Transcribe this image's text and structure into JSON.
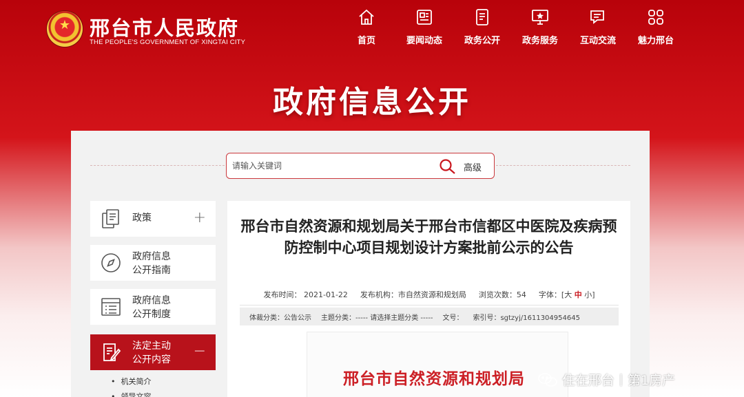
{
  "header": {
    "site_title": "邢台市人民政府",
    "site_subtitle": "THE PEOPLE'S GOVERNMENT OF XINGTAI CITY",
    "nav": [
      {
        "label": "首页",
        "icon": "home-icon"
      },
      {
        "label": "要闻动态",
        "icon": "news-icon"
      },
      {
        "label": "政务公开",
        "icon": "document-icon"
      },
      {
        "label": "政务服务",
        "icon": "monitor-star-icon"
      },
      {
        "label": "互动交流",
        "icon": "chat-icon"
      },
      {
        "label": "魅力邢台",
        "icon": "grid-icon"
      }
    ]
  },
  "hero": {
    "title": "政府信息公开"
  },
  "search": {
    "placeholder": "请输入关键词",
    "advanced_label": "高级"
  },
  "sidebar": {
    "items": [
      {
        "label_line1": "政策",
        "label_line2": "",
        "icon": "document-copy-icon",
        "toggle": "+"
      },
      {
        "label_line1": "政府信息",
        "label_line2": "公开指南",
        "icon": "compass-icon",
        "toggle": ""
      },
      {
        "label_line1": "政府信息",
        "label_line2": "公开制度",
        "icon": "list-icon",
        "toggle": ""
      },
      {
        "label_line1": "法定主动",
        "label_line2": "公开内容",
        "icon": "edit-document-icon",
        "toggle": "−"
      }
    ],
    "sub_items": [
      "机关简介",
      "领导文容"
    ]
  },
  "article": {
    "title": "邢台市自然资源和规划局关于邢台市信都区中医院及疾病预防控制中心项目规划设计方案批前公示的公告",
    "meta": {
      "publish_date_label": "发布时间：",
      "publish_date": "2021-01-22",
      "org_label": "发布机构：",
      "org": "市自然资源和规划局",
      "views_label": "浏览次数：",
      "views": "54",
      "font_label": "字体：[",
      "font_large": "大",
      "font_mid": "中",
      "font_small": "小]"
    },
    "meta2": {
      "genre": "体裁分类：公告公示",
      "topic": "主题分类：----- 请选择主题分类 -----",
      "doc_no": "文号：",
      "index_no": "索引号：sgtzyj/1611304954645"
    },
    "document_header": "邢台市自然资源和规划局"
  },
  "watermark": {
    "text": "住在邢台丨第1房产"
  },
  "colors": {
    "brand_red": "#c9171e",
    "panel_bg": "#f2f2f2"
  }
}
